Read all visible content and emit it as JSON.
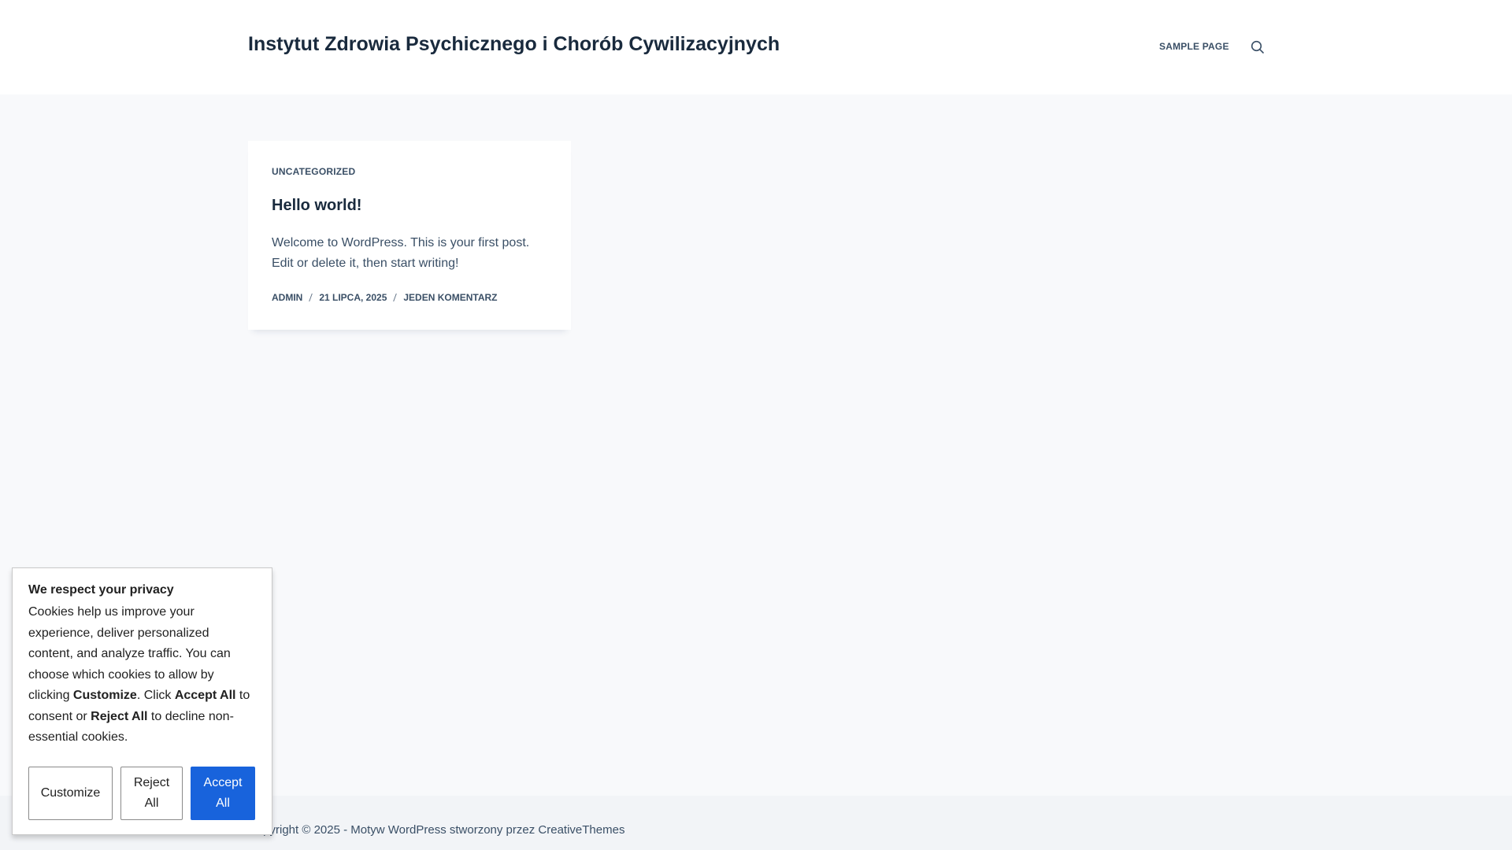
{
  "header": {
    "site_title": "Instytut Zdrowia Psychicznego i Chorób Cywilizacyjnych",
    "nav_items": [
      {
        "label": "SAMPLE PAGE"
      }
    ],
    "search_icon": "search-icon"
  },
  "post": {
    "category": "UNCATEGORIZED",
    "title": "Hello world!",
    "excerpt": "Welcome to WordPress. This is your first post. Edit or delete it, then start writing!",
    "meta": {
      "author": "ADMIN",
      "date": "21 LIPCA, 2025",
      "comments": "JEDEN KOMENTARZ"
    }
  },
  "footer": {
    "prefix": "Copyright © 2025 - Motyw WordPress stworzony przez ",
    "link": "CreativeThemes"
  },
  "cookie": {
    "title": "We respect your privacy",
    "text_1": "Cookies help us improve your experience, deliver personalized content, and analyze traffic. You can choose which cookies to allow by clicking ",
    "bold_customize": "Customize",
    "text_2": ". Click ",
    "bold_accept": "Accept All",
    "text_3": " to consent or ",
    "bold_reject": "Reject All",
    "text_4": " to decline non-essential cookies.",
    "buttons": {
      "customize": "Customize",
      "reject": "Reject All",
      "accept": "Accept All"
    }
  },
  "colors": {
    "accent": "#1863dc",
    "heading": "#192a3d",
    "text": "#3a4f66",
    "page_bg": "#f8f9fb"
  }
}
